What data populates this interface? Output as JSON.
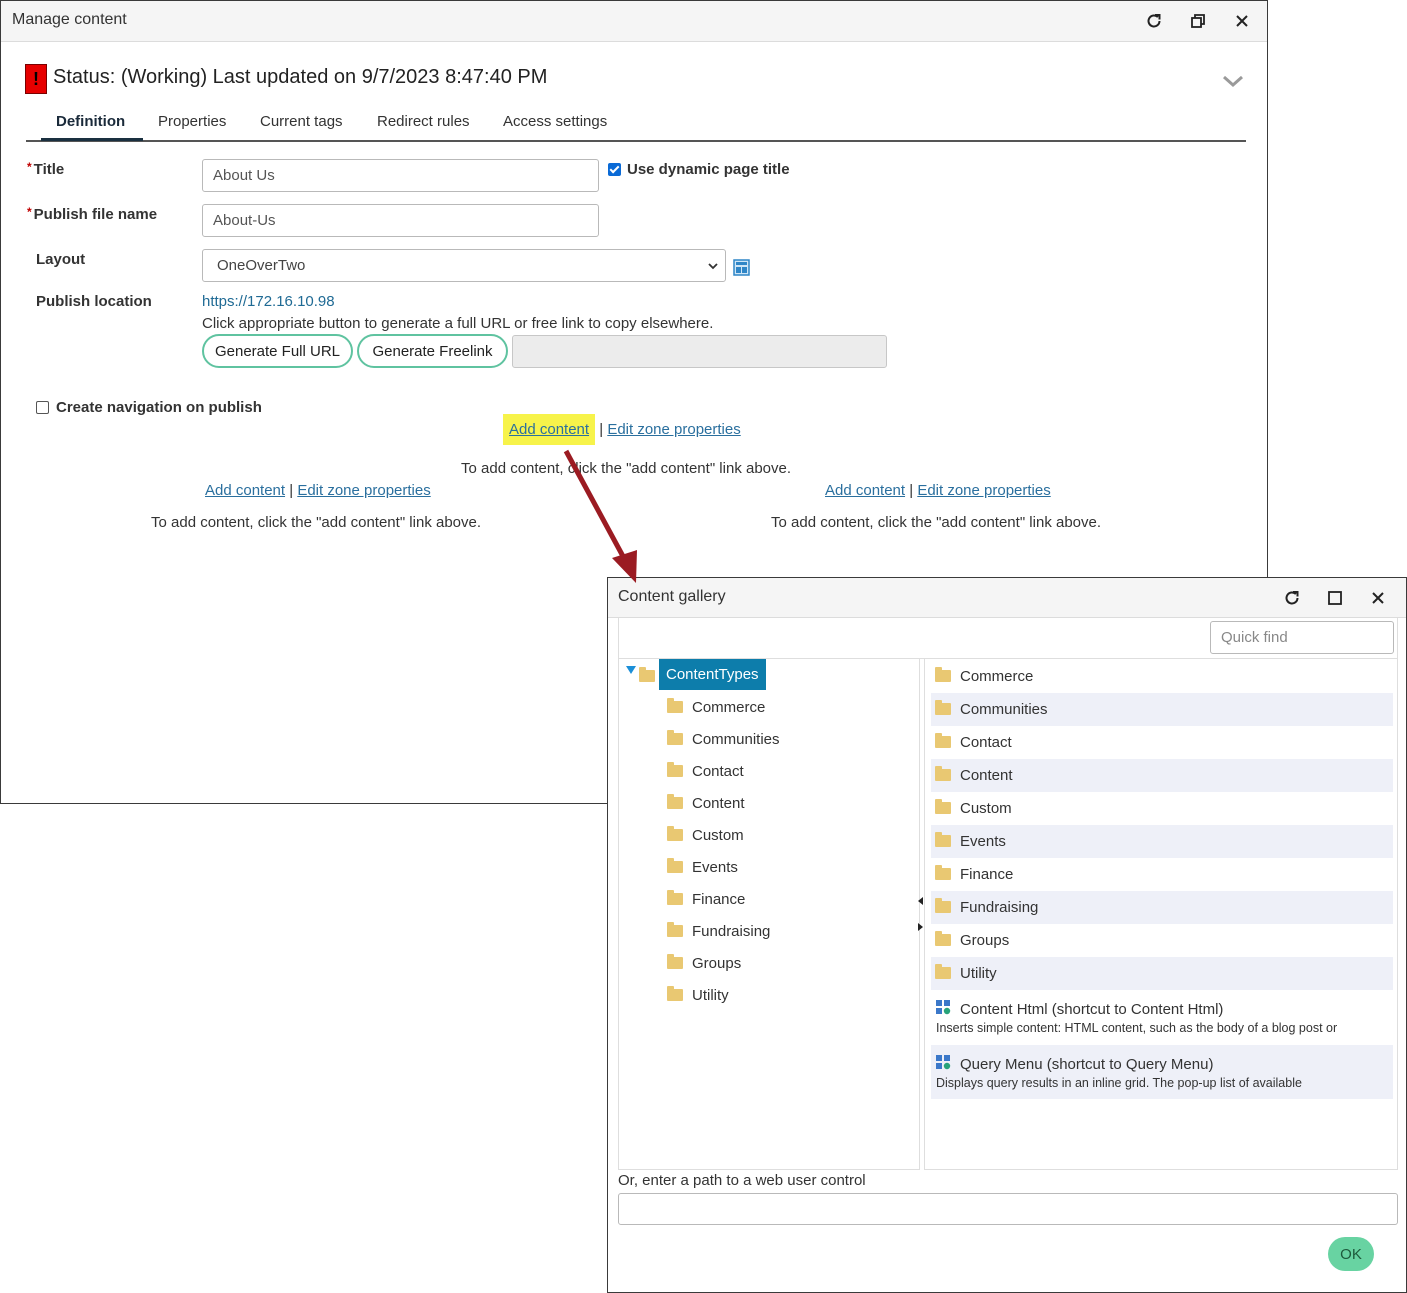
{
  "main_window": {
    "title": "Manage content",
    "status": "Status: (Working) Last updated on 9/7/2023 8:47:40 PM",
    "status_icon": "!",
    "tabs": [
      "Definition",
      "Properties",
      "Current tags",
      "Redirect rules",
      "Access settings"
    ],
    "active_tab": "Definition",
    "form": {
      "title_label": "Title",
      "title_value": "About Us",
      "dynamic_title_label": "Use dynamic page title",
      "dynamic_title_checked": true,
      "publish_file_label": "Publish file name",
      "publish_file_value": "About-Us",
      "layout_label": "Layout",
      "layout_value": "OneOverTwo",
      "publish_location_label": "Publish location",
      "publish_location_url": "https://172.16.10.98",
      "publish_location_hint": "Click appropriate button to generate a full URL or free link to copy elsewhere.",
      "generate_full_url": "Generate Full URL",
      "generate_freelink": "Generate Freelink",
      "create_nav_label": "Create navigation on publish",
      "create_nav_checked": false
    },
    "zones": {
      "add_content": "Add content",
      "separator": "|",
      "edit_zone": "Edit zone properties",
      "hint": "To add content, click the \"add content\" link above."
    }
  },
  "dialog": {
    "title": "Content gallery",
    "quick_find_placeholder": "Quick find",
    "tree_root": "ContentTypes",
    "tree_items": [
      "Commerce",
      "Communities",
      "Contact",
      "Content",
      "Custom",
      "Events",
      "Finance",
      "Fundraising",
      "Groups",
      "Utility"
    ],
    "list_folders": [
      "Commerce",
      "Communities",
      "Contact",
      "Content",
      "Custom",
      "Events",
      "Finance",
      "Fundraising",
      "Groups",
      "Utility"
    ],
    "list_widgets": [
      {
        "name": "Content Html (shortcut to Content Html)",
        "desc": "Inserts simple content: HTML content, such as the body of a blog post or"
      },
      {
        "name": "Query Menu (shortcut to Query Menu)",
        "desc": "Displays query results in an inline grid. The pop-up list of available"
      }
    ],
    "path_label": "Or, enter a path to a web user control",
    "path_value": "",
    "ok_label": "OK"
  },
  "colors": {
    "accent_teal": "#0d7dab",
    "button_border": "#5fc3a0",
    "ok_button": "#68d3a2",
    "arrow": "#9b1b22",
    "highlight": "#f7f34a",
    "status_red": "#e60000"
  }
}
